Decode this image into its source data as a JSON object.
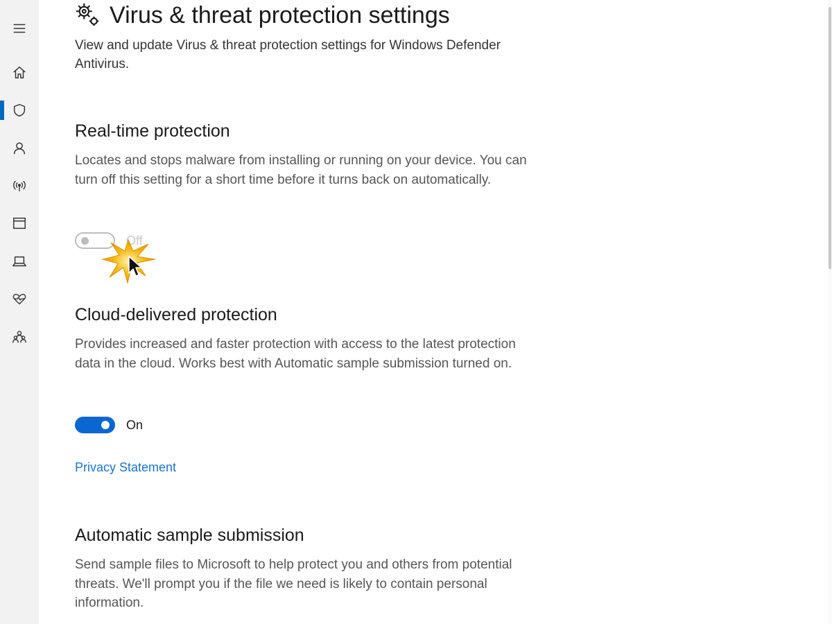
{
  "sidebar": {
    "items": [
      {
        "icon": "menu-icon",
        "active": false
      },
      {
        "icon": "home-icon",
        "active": false
      },
      {
        "icon": "shield-icon",
        "active": true
      },
      {
        "icon": "person-icon",
        "active": false
      },
      {
        "icon": "wireless-icon",
        "active": false
      },
      {
        "icon": "app-browser-icon",
        "active": false
      },
      {
        "icon": "laptop-icon",
        "active": false
      },
      {
        "icon": "heart-pulse-icon",
        "active": false
      },
      {
        "icon": "family-icon",
        "active": false
      }
    ],
    "accent_color": "#0067c0"
  },
  "page": {
    "title": "Virus & threat protection settings",
    "title_icon": "gear-icon",
    "subtitle": "View and update Virus & threat protection settings for Windows Defender Antivirus."
  },
  "realtime": {
    "title": "Real-time protection",
    "description": "Locates and stops malware from installing or running on your device. You can turn off this setting for a short time before it turns back on automatically.",
    "toggle_state": "Off"
  },
  "cloud": {
    "title": "Cloud-delivered protection",
    "description": "Provides increased and faster protection with access to the latest protection data in the cloud.  Works best with Automatic sample submission turned on.",
    "toggle_state": "On",
    "privacy_link": "Privacy Statement"
  },
  "sample": {
    "title": "Automatic sample submission",
    "description": "Send sample files to Microsoft to help protect you and others from potential threats.  We'll prompt you if the file we need is likely to contain personal information."
  },
  "colors": {
    "toggle_on": "#0a66d1",
    "link": "#1a73c9"
  }
}
